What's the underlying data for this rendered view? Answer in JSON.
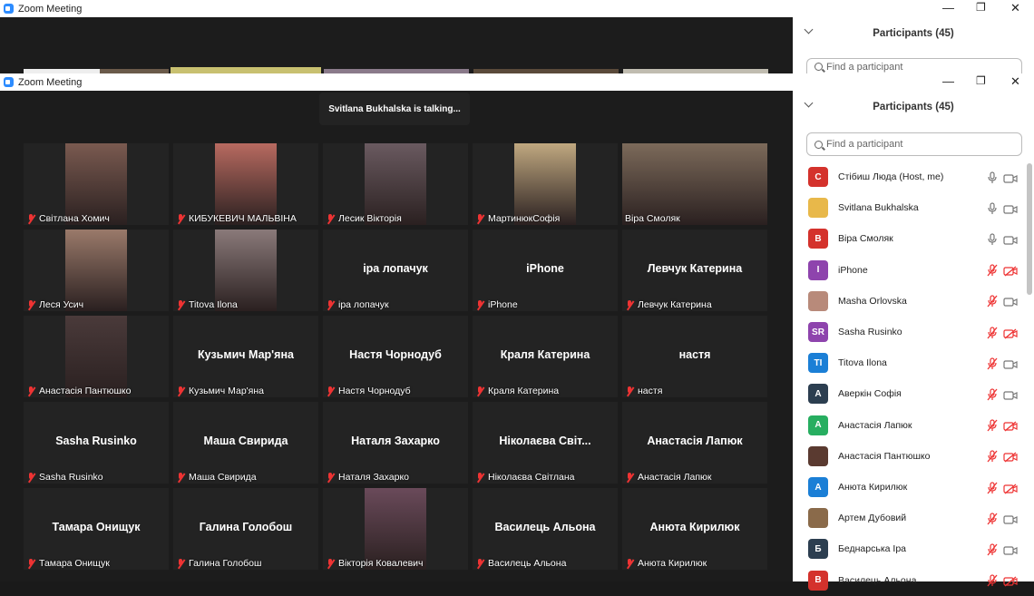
{
  "app": {
    "window_title": "Zoom Meeting"
  },
  "window_controls": {
    "minimize": "—",
    "restore": "❐",
    "close": "✕"
  },
  "talking_banner": "Svitlana Bukhalska is talking...",
  "participants_panel": {
    "title": "Participants (45)",
    "search_placeholder": "Find a participant",
    "list": [
      {
        "name": "Стібиш Люда (Host, me)",
        "avatar_letter": "С",
        "avatar_color": "#d4322c",
        "mic": "on",
        "cam": "off"
      },
      {
        "name": "Svitlana Bukhalska",
        "avatar_letter": "",
        "avatar_color": "#e8b84a",
        "mic": "on",
        "cam": "off"
      },
      {
        "name": "Віра Смоляк",
        "avatar_letter": "В",
        "avatar_color": "#d4322c",
        "mic": "on",
        "cam": "off"
      },
      {
        "name": "iPhone",
        "avatar_letter": "I",
        "avatar_color": "#8e44ad",
        "mic": "muted",
        "cam": "muted"
      },
      {
        "name": "Masha Orlovska",
        "avatar_letter": "",
        "avatar_color": "#b88a7a",
        "mic": "muted",
        "cam": "off"
      },
      {
        "name": "Sasha Rusinko",
        "avatar_letter": "SR",
        "avatar_color": "#8e44ad",
        "mic": "muted",
        "cam": "muted"
      },
      {
        "name": "Titova Ilona",
        "avatar_letter": "TI",
        "avatar_color": "#1b7fd6",
        "mic": "muted",
        "cam": "off"
      },
      {
        "name": "Аверкін Софія",
        "avatar_letter": "А",
        "avatar_color": "#2c3e50",
        "mic": "muted",
        "cam": "off"
      },
      {
        "name": "Анастасія Лапюк",
        "avatar_letter": "А",
        "avatar_color": "#27ae60",
        "mic": "muted",
        "cam": "muted"
      },
      {
        "name": "Анастасія Пантюшко",
        "avatar_letter": "",
        "avatar_color": "#5a3a30",
        "mic": "muted",
        "cam": "muted"
      },
      {
        "name": "Анюта Кирилюк",
        "avatar_letter": "А",
        "avatar_color": "#1b7fd6",
        "mic": "muted",
        "cam": "muted"
      },
      {
        "name": "Артем Дубовий",
        "avatar_letter": "",
        "avatar_color": "#8a6a4a",
        "mic": "muted",
        "cam": "off"
      },
      {
        "name": "Беднарська Іра",
        "avatar_letter": "Б",
        "avatar_color": "#2c3e50",
        "mic": "muted",
        "cam": "off"
      },
      {
        "name": "Василець Альона",
        "avatar_letter": "В",
        "avatar_color": "#d4322c",
        "mic": "muted",
        "cam": "muted"
      }
    ]
  },
  "grid": [
    {
      "label": "Світлана Хомич",
      "center": "",
      "video": true,
      "muted": true
    },
    {
      "label": "КИБУКЕВИЧ МАЛЬВІНА",
      "center": "",
      "video": true,
      "muted": true
    },
    {
      "label": "Лесик Вікторія",
      "center": "",
      "video": true,
      "muted": true
    },
    {
      "label": "МартинюкСофія",
      "center": "",
      "video": true,
      "muted": true
    },
    {
      "label": "Віра Смоляк",
      "center": "",
      "video": true,
      "muted": false
    },
    {
      "label": "Леся Усич",
      "center": "",
      "video": true,
      "muted": true
    },
    {
      "label": "Titova Ilona",
      "center": "",
      "video": true,
      "muted": true
    },
    {
      "label": "іра лопачук",
      "center": "іра лопачук",
      "video": false,
      "muted": true
    },
    {
      "label": "iPhone",
      "center": "iPhone",
      "video": false,
      "muted": true
    },
    {
      "label": "Левчук Катерина",
      "center": "Левчук Катерина",
      "video": false,
      "muted": true
    },
    {
      "label": "Анастасія Пантюшко",
      "center": "",
      "video": true,
      "muted": true
    },
    {
      "label": "Кузьмич Мар'яна",
      "center": "Кузьмич Мар'яна",
      "video": false,
      "muted": true
    },
    {
      "label": "Настя Чорнодуб",
      "center": "Настя Чорнодуб",
      "video": false,
      "muted": true
    },
    {
      "label": "Краля Катерина",
      "center": "Краля Катерина",
      "video": false,
      "muted": true
    },
    {
      "label": "настя",
      "center": "настя",
      "video": false,
      "muted": true
    },
    {
      "label": "Sasha Rusinko",
      "center": "Sasha Rusinko",
      "video": false,
      "muted": true
    },
    {
      "label": "Маша Свирида",
      "center": "Маша Свирида",
      "video": false,
      "muted": true
    },
    {
      "label": "Наталя Захарко",
      "center": "Наталя Захарко",
      "video": false,
      "muted": true
    },
    {
      "label": "Ніколаєва Світлана",
      "center": "Ніколаєва Світ...",
      "video": false,
      "muted": true
    },
    {
      "label": "Анастасія Лапюк",
      "center": "Анастасія Лапюк",
      "video": false,
      "muted": true
    },
    {
      "label": "Тамара Онищук",
      "center": "Тамара Онищук",
      "video": false,
      "muted": true
    },
    {
      "label": "Галина Голобош",
      "center": "Галина Голобош",
      "video": false,
      "muted": true
    },
    {
      "label": "Вікторія Ковалевич",
      "center": "",
      "video": true,
      "muted": true
    },
    {
      "label": "Василець Альона",
      "center": "Василець Альона",
      "video": false,
      "muted": true
    },
    {
      "label": "Анюта Кирилюк",
      "center": "Анюта Кирилюк",
      "video": false,
      "muted": true
    }
  ]
}
